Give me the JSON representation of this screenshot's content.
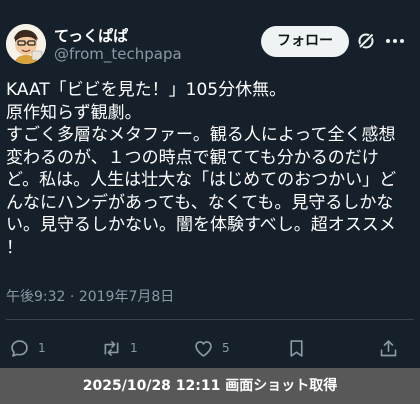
{
  "author": {
    "display_name": "てっくぱぱ",
    "handle": "@from_techpapa",
    "avatar_icon": "cartoon-man-avatar"
  },
  "header": {
    "follow_label": "フォロー",
    "grok_icon": "grok-icon",
    "more_icon": "more-icon"
  },
  "tweet": {
    "lines": [
      "KAAT「ビビを見た！」105分休無。",
      "原作知らず観劇。",
      "すごく多層なメタファー。観る人によって全く感想",
      "変わるのが、１つの時点で観てても分かるのだけ",
      "ど。私は。人生は壮大な「はじめてのおつかい」ど",
      "んなにハンデがあっても、なくても。見守るしかな",
      "い。見守るしかない。闇を体験すべし。超オススメ",
      "！"
    ],
    "time": "午後9:32",
    "separator": "·",
    "date": "2019年7月8日"
  },
  "actions": {
    "reply_count": "1",
    "retweet_count": "1",
    "like_count": "5"
  },
  "capture_banner": "2025/10/28 12:11 画面ショット取得",
  "colors": {
    "background": "#15202b",
    "text": "#ffffff",
    "secondary_text": "#8b98a5",
    "divider": "#38444d",
    "follow_button_bg": "#eff3f4",
    "banner_bg": "#585858"
  }
}
